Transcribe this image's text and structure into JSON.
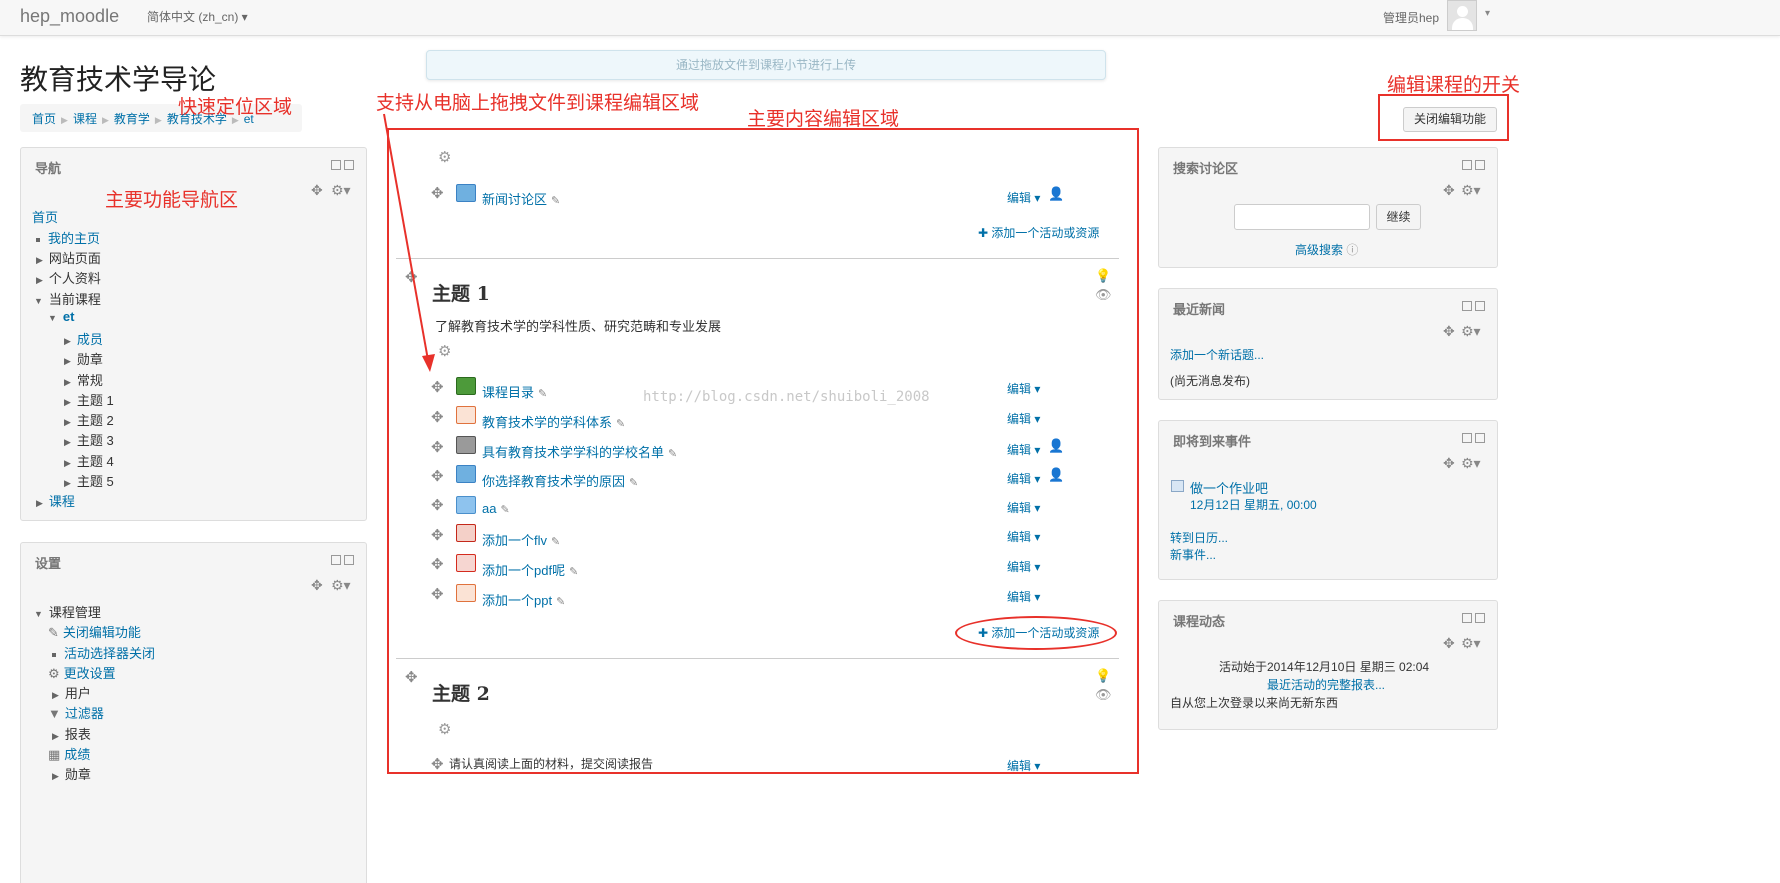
{
  "navbar": {
    "brand": "hep_moodle",
    "language": "简体中文 (zh_cn) ▾",
    "user_name": "管理员hep",
    "user_caret": "▾"
  },
  "course": {
    "title": "教育技术学导论",
    "breadcrumb": [
      "首页",
      "课程",
      "教育学",
      "教育技术学",
      "et"
    ],
    "dropzone_text": "通过拖放文件到课程小节进行上传",
    "edit_toggle_label": "关闭编辑功能"
  },
  "annotations": {
    "quick_locate": "快速定位区域",
    "drag_support": "支持从电脑上拖拽文件到课程编辑区域",
    "main_edit_area": "主要内容编辑区域",
    "edit_switch": "编辑课程的开关",
    "main_nav_area": "主要功能导航区",
    "watermark": "http://blog.csdn.net/shuiboli_2008"
  },
  "navigation_block": {
    "title": "导航",
    "home": "首页",
    "my_home": "我的主页",
    "site_pages": "网站页面",
    "profile": "个人资料",
    "current_course": "当前课程",
    "course_short": "et",
    "course_children": [
      "成员",
      "勋章",
      "常规",
      "主题 1",
      "主题 2",
      "主题 3",
      "主题 4",
      "主题 5"
    ],
    "courses": "课程"
  },
  "settings_block": {
    "title": "设置",
    "course_admin": "课程管理",
    "items": [
      "关闭编辑功能",
      "活动选择器关闭",
      "更改设置",
      "用户",
      "过滤器",
      "报表",
      "成绩",
      "勋章"
    ]
  },
  "sections": {
    "section0": {
      "activities": [
        {
          "label": "新闻讨论区",
          "edit": "编辑",
          "icon": "forum-icon"
        }
      ],
      "add_activity": "添加一个活动或资源"
    },
    "section1": {
      "title": "主题 1",
      "summary": "了解教育技术学的学科性质、研究范畴和专业发展",
      "activities": [
        {
          "label": "课程目录",
          "edit": "编辑",
          "icon": "book-icon"
        },
        {
          "label": "教育技术学的学科体系",
          "edit": "编辑",
          "icon": "ppt-file-icon"
        },
        {
          "label": "具有教育技术学学科的学校名单",
          "edit": "编辑",
          "icon": "database-icon"
        },
        {
          "label": "你选择教育技术学的原因",
          "edit": "编辑",
          "icon": "forum-icon"
        },
        {
          "label": "aa",
          "edit": "编辑",
          "icon": "folder-icon"
        },
        {
          "label": "添加一个flv",
          "edit": "编辑",
          "icon": "flash-file-icon"
        },
        {
          "label": "添加一个pdf呢",
          "edit": "编辑",
          "icon": "pdf-file-icon"
        },
        {
          "label": "添加一个ppt",
          "edit": "编辑",
          "icon": "ppt-file-icon"
        }
      ],
      "add_activity": "添加一个活动或资源"
    },
    "section2": {
      "title": "主题 2",
      "activity_label": "请认真阅读上面的材料，提交阅读报告",
      "edit": "编辑"
    }
  },
  "search_block": {
    "title": "搜索讨论区",
    "input_value": "",
    "go_button": "继续",
    "advanced_search": "高级搜索"
  },
  "news_block": {
    "title": "最近新闻",
    "add_topic": "添加一个新话题...",
    "empty": "(尚无消息发布)"
  },
  "events_block": {
    "title": "即将到来事件",
    "event_name": "做一个作业吧",
    "event_date": "12月12日 星期五, 00:00",
    "goto_calendar": "转到日历...",
    "new_event": "新事件..."
  },
  "activity_block": {
    "title": "课程动态",
    "since": "活动始于2014年12月10日 星期三 02:04",
    "full_report": "最近活动的完整报表...",
    "nothing_new": "自从您上次登录以来尚无新东西"
  },
  "colors": {
    "annotation_red": "#e8312a",
    "link_blue": "#0070a8"
  }
}
